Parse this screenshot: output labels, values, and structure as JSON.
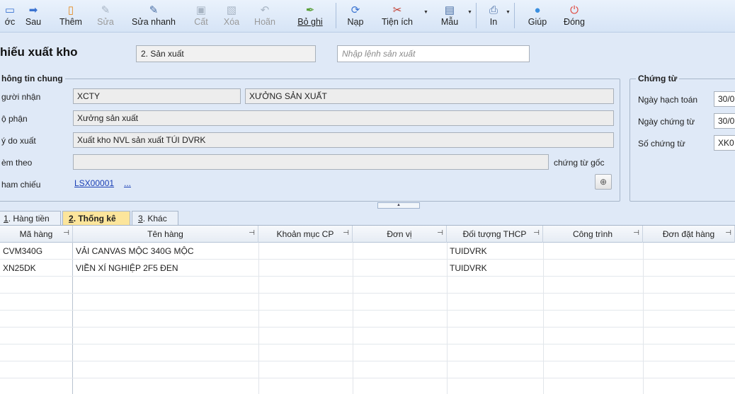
{
  "toolbar": {
    "items": [
      {
        "label": "ớc",
        "icon": "previous-icon",
        "disabled": false
      },
      {
        "label": "Sau",
        "icon": "next-icon",
        "disabled": false
      },
      {
        "label": "Thêm",
        "icon": "add-doc-icon",
        "disabled": false
      },
      {
        "label": "Sửa",
        "icon": "edit-icon",
        "disabled": true
      },
      {
        "label": "Sửa nhanh",
        "icon": "quick-edit-icon",
        "disabled": false
      },
      {
        "label": "Cất",
        "icon": "save-icon",
        "disabled": true
      },
      {
        "label": "Xóa",
        "icon": "delete-icon",
        "disabled": true
      },
      {
        "label": "Hoãn",
        "icon": "undo-icon",
        "disabled": true
      },
      {
        "label": "Bỏ ghi",
        "icon": "unpost-icon",
        "disabled": false
      },
      {
        "label": "Nạp",
        "icon": "reload-icon",
        "disabled": false
      },
      {
        "label": "Tiện ích",
        "icon": "tools-icon",
        "disabled": false
      },
      {
        "label": "Mẫu",
        "icon": "template-icon",
        "disabled": false
      },
      {
        "label": "In",
        "icon": "print-icon",
        "disabled": false
      },
      {
        "label": "Giúp",
        "icon": "help-icon",
        "disabled": false
      },
      {
        "label": "Đóng",
        "icon": "power-icon",
        "disabled": false
      }
    ]
  },
  "header": {
    "title": "hiếu xuất kho",
    "type_value": "2. Sản xuất",
    "command_placeholder": "Nhập lệnh sản xuất"
  },
  "general": {
    "legend": "hông tin chung",
    "receiver_label": "gười nhận",
    "receiver_code": "XCTY",
    "receiver_name": "XƯỞNG SẢN XUẤT",
    "dept_label": "ộ phận",
    "dept_value": "Xưởng sản xuất",
    "reason_label": "ý do xuất",
    "reason_value": "Xuất kho NVL sản xuất TÚI DVRK",
    "attach_label": "èm theo",
    "attach_value": "",
    "attach_suffix": "chứng từ gốc",
    "ref_label": "ham chiếu",
    "ref_link": "LSX00001",
    "ref_more": "..."
  },
  "voucher": {
    "legend": "Chứng từ",
    "posting_date_label": "Ngày hạch toán",
    "posting_date_value": "30/0",
    "voucher_date_label": "Ngày chứng từ",
    "voucher_date_value": "30/0",
    "voucher_no_label": "Số chứng từ",
    "voucher_no_value": "XK0"
  },
  "tabs": [
    {
      "num": "1",
      "text": ". Hàng tiền"
    },
    {
      "num": "2",
      "text": ". Thống kê"
    },
    {
      "num": "3",
      "text": ". Khác"
    }
  ],
  "grid": {
    "columns": [
      "Mã hàng",
      "Tên hàng",
      "Khoản mục CP",
      "Đơn vị",
      "Đối tượng THCP",
      "Công trình",
      "Đơn đặt hàng"
    ],
    "rows": [
      {
        "code": "CVM340G",
        "name": "VẢI CANVAS MỘC 340G MỘC",
        "cost_item": "",
        "unit": "",
        "object": "TUIDVRK",
        "project": "",
        "order": ""
      },
      {
        "code": "XN25DK",
        "name": "VIỀN XÍ NGHIỆP 2F5 ĐEN",
        "cost_item": "",
        "unit": "",
        "object": "TUIDVRK",
        "project": "",
        "order": ""
      }
    ]
  }
}
